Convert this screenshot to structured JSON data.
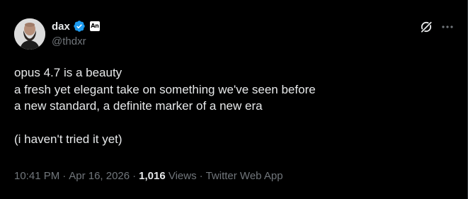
{
  "tweet": {
    "author": {
      "display_name": "dax",
      "handle": "@thdxr",
      "verified_color": "#1d9bf0",
      "affiliate_badge": "An",
      "avatar_icon": "avatar-bearded-man"
    },
    "body_lines": [
      "opus 4.7 is a beauty",
      "a fresh yet elegant take on something we've seen before",
      "a new standard, a definite marker of a new era",
      "",
      "(i haven't tried it yet)"
    ],
    "meta": {
      "time": "10:41 PM",
      "separator": "·",
      "date": "Apr 16, 2026",
      "views_count": "1,016",
      "views_label": "Views",
      "source": "Twitter Web App"
    },
    "icons": {
      "grok": "grok-icon",
      "more": "more-icon"
    }
  },
  "colors": {
    "background": "#000000",
    "primary_text": "#e7e9ea",
    "secondary_text": "#71767b",
    "verified_blue": "#1d9bf0"
  }
}
